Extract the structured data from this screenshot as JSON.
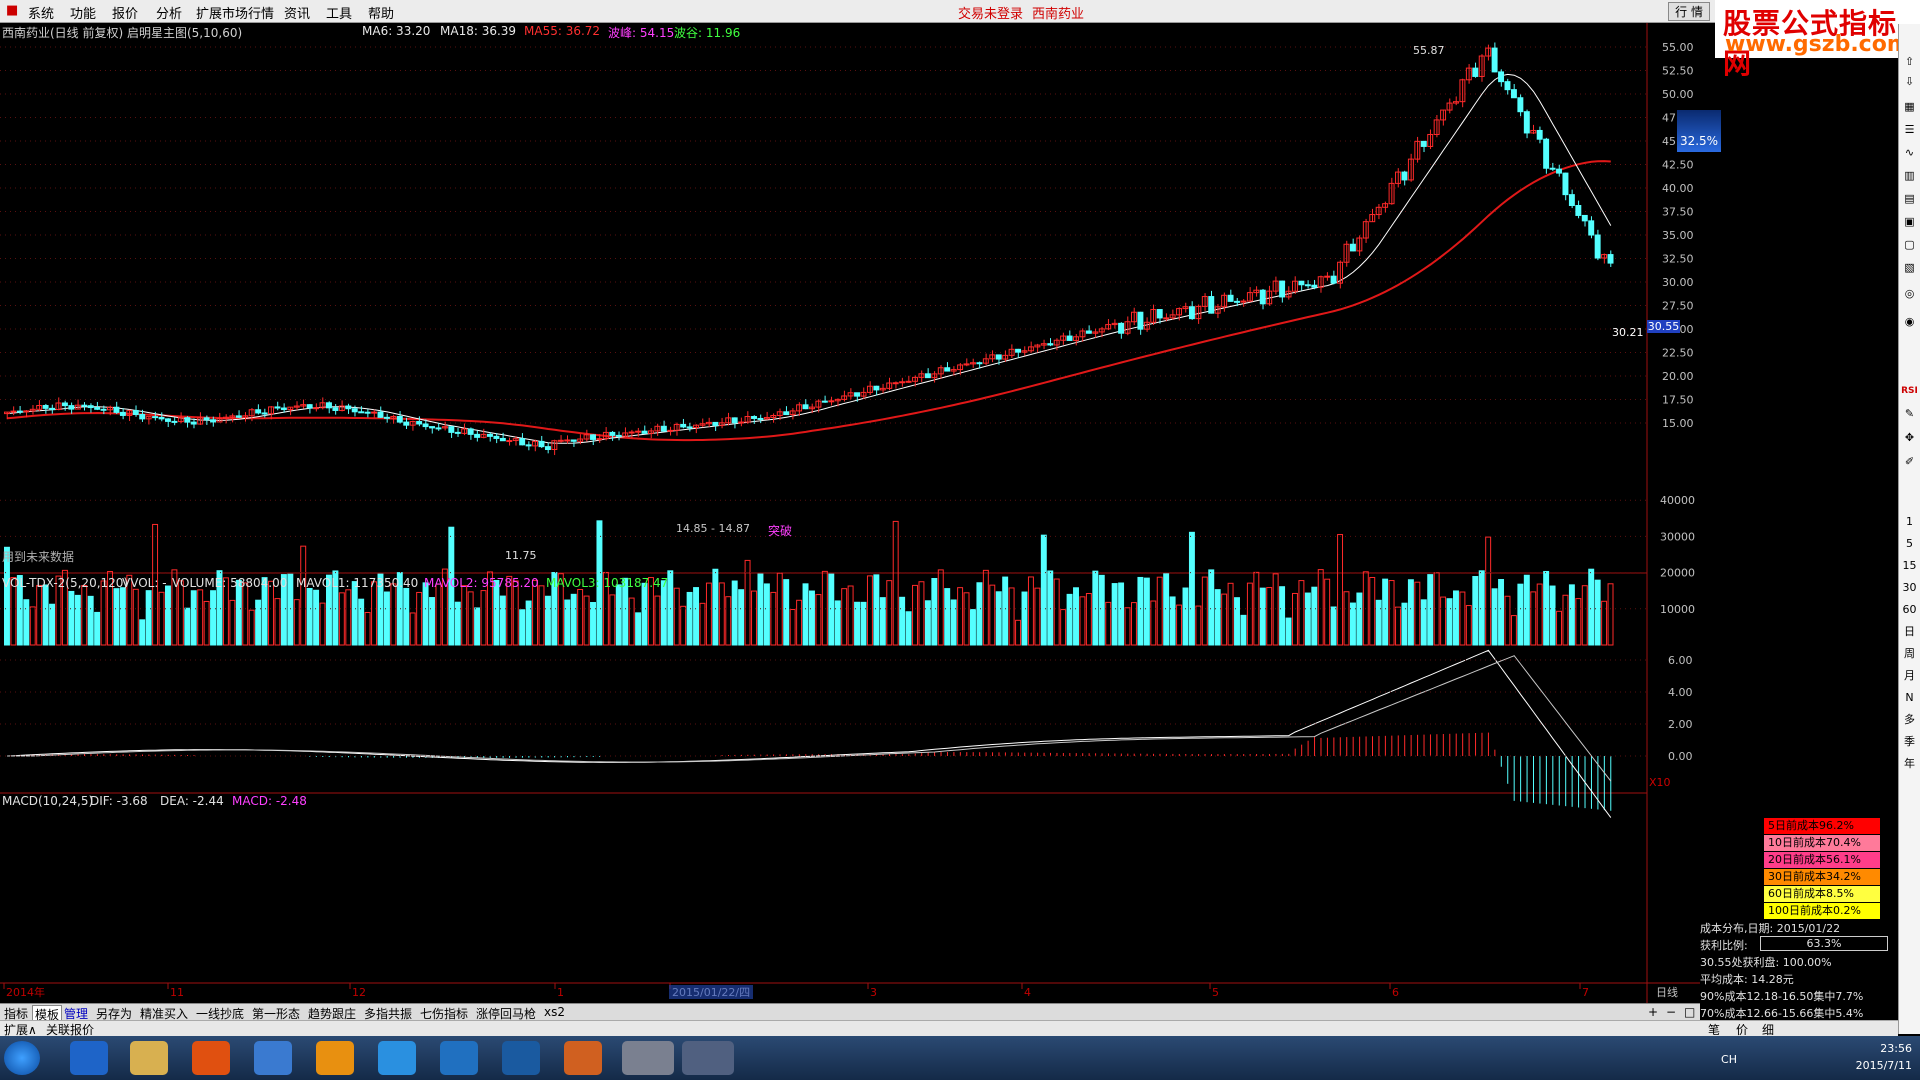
{
  "menu": {
    "items": [
      "系统",
      "功能",
      "报价",
      "分析",
      "扩展市场行情",
      "资讯",
      "工具",
      "帮助"
    ],
    "center_left": "交易未登录",
    "center_right": "西南药业",
    "right_tag": "行 情"
  },
  "logo": {
    "line1": "股票公式指标网",
    "line2": "www.gszb.com"
  },
  "main_chart": {
    "title": "西南药业(日线 前复权) 启明星主图(5,10,60)",
    "ma6": "MA6: 33.20",
    "ma18": "MA18: 36.39",
    "ma55": "MA55: 36.72",
    "bofeng": "波峰: 54.15",
    "bogu": "波谷: 11.96",
    "price_labels": [
      "55.00",
      "52.50",
      "50.00",
      "47.50",
      "45.00",
      "42.50",
      "40.00",
      "37.50",
      "35.00",
      "32.50",
      "30.00",
      "27.50",
      "25.00",
      "22.50",
      "20.00",
      "17.50",
      "15.00"
    ],
    "high_marker": "55.87",
    "low_marker": "11.75",
    "last_price_tag": "30.55",
    "last_price_left": "30.21",
    "range_text": "14.85 - 14.87",
    "breakout_text": "突破",
    "future_data_text": "用到未来数据",
    "pct_badge": "32.5%",
    "colors": {
      "up": "#ff2a2a",
      "down": "#54ffff",
      "ma_red": "#e01818",
      "ma_white": "#ffffff",
      "ma_grey": "#9a9a9a"
    }
  },
  "volume_chart": {
    "header_name": "VOL-TDX-2(5,20,120)",
    "vvol": "VVOL: -",
    "volume": "VOLUME: 58804.00",
    "mavol1": "MAVOL1: 117350.40",
    "mavol2": "MAVOL2: 95785.20",
    "mavol3": "MAVOL3: 103187.47",
    "axis_labels": [
      "40000",
      "30000",
      "20000",
      "10000"
    ],
    "unit": "X10"
  },
  "macd_chart": {
    "header_name": "MACD(10,24,5)",
    "dif": "DIF: -3.68",
    "dea": "DEA: -2.44",
    "macd": "MACD: -2.48",
    "axis_labels": [
      "6.00",
      "4.00",
      "2.00",
      "0.00"
    ]
  },
  "time_axis": {
    "labels": [
      "2014年",
      "11",
      "12",
      "1",
      "2015/01/22/四",
      "3",
      "4",
      "5",
      "6",
      "7"
    ],
    "period": "日线"
  },
  "cost_distribution": {
    "rows": [
      {
        "label": "5日前成本96.2%",
        "color": "#ff0000"
      },
      {
        "label": "10日前成本70.4%",
        "color": "#ff7a9a"
      },
      {
        "label": "20日前成本56.1%",
        "color": "#ff3d8a"
      },
      {
        "label": "30日前成本34.2%",
        "color": "#ff8a00"
      },
      {
        "label": "60日前成本8.5%",
        "color": "#ffff40"
      },
      {
        "label": "100日前成本0.2%",
        "color": "#ffff00"
      }
    ],
    "date_line": "成本分布,日期: 2015/01/22",
    "profit_label": "获利比例:",
    "profit_value": "63.3%",
    "profit_at_price": "30.55处获利盘: 100.00%",
    "avg_cost": "平均成本: 14.28元",
    "c90": "90%成本12.18-16.50集中7.7%",
    "c70": "70%成本12.66-15.66集中5.4%"
  },
  "bottom_tabs": [
    "指标",
    "模板",
    "管理",
    "另存为",
    "精准买入",
    "一线抄底",
    "第一形态",
    "趋势跟庄",
    "多指共振",
    "七伤指标",
    "涨停回马枪",
    "xs2"
  ],
  "bottom_row2": [
    "扩展∧",
    "关联报价"
  ],
  "bottom_right_small": [
    "笔",
    "价",
    "细"
  ],
  "right_strip_labels": [
    "RSI",
    "1",
    "5",
    "15",
    "30",
    "60",
    "日",
    "周",
    "月",
    "N",
    "多",
    "季",
    "年"
  ],
  "taskbar": {
    "time": "23:56",
    "date": "2015/7/11",
    "lang": "CH"
  }
}
